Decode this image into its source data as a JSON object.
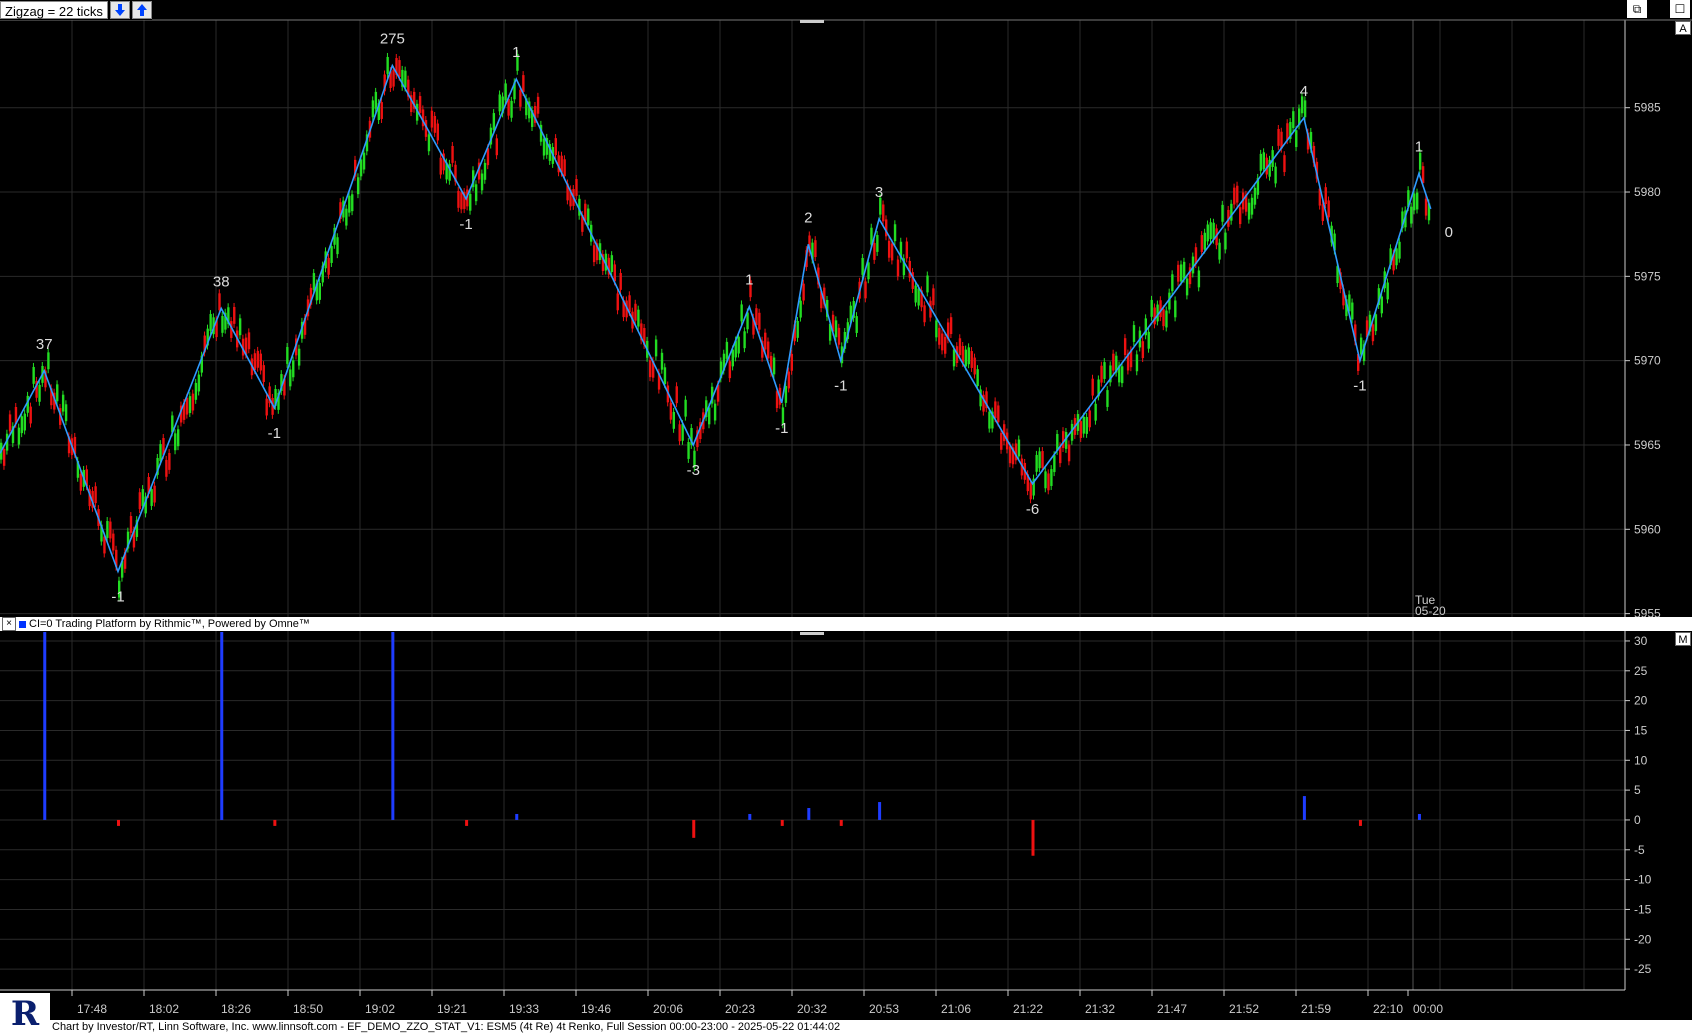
{
  "toolbar": {
    "zigzag_label": "Zigzag = 22 ticks",
    "down_icon": "arrow-down-icon",
    "up_icon": "arrow-up-icon"
  },
  "window_controls": {
    "restore": "⧉",
    "close": "☐"
  },
  "pane_tags": {
    "price": "A",
    "stat": "M"
  },
  "indicator_bar": {
    "close_label": "×",
    "text": "CI=0  Trading Platform by Rithmic™, Powered by Omne™"
  },
  "footer": {
    "text": "Chart by Investor/RT, Linn Software, Inc. www.linnsoft.com - EF_DEMO_ZZO_STAT_V1: ESM5 (4t Re) 4t Renko, Full Session 00:00-23:00 - 2025-05-22 01:44:02"
  },
  "colors": {
    "up": "#22dd22",
    "down": "#ee1111",
    "zigzag": "#2e9bff",
    "hist_up": "#1e3cff",
    "hist_down": "#ee1111",
    "grid": "#2a2a2a"
  },
  "date_label": [
    "Tue",
    "05-20"
  ],
  "chart_data": {
    "type": "line",
    "title": "",
    "price_axis": {
      "ticks": [
        "5985",
        "5980",
        "5975",
        "5970",
        "5965",
        "5960",
        "5955"
      ],
      "ylim": [
        5954.8,
        5990.2
      ]
    },
    "stat_axis": {
      "ticks": [
        "30",
        "25",
        "20",
        "15",
        "10",
        "5",
        "0",
        "-5",
        "-10",
        "-15",
        "-20",
        "-25"
      ],
      "ylim": [
        -28.5,
        31.5
      ]
    },
    "time_labels": [
      "17:48",
      "18:02",
      "18:26",
      "18:50",
      "19:02",
      "19:21",
      "19:33",
      "19:46",
      "20:06",
      "20:23",
      "20:32",
      "20:53",
      "21:06",
      "21:22",
      "21:32",
      "21:47",
      "21:52",
      "21:59",
      "22:10",
      "00:00"
    ],
    "zigzag": [
      {
        "bar": 0,
        "price": 5964.5,
        "label": ""
      },
      {
        "bar": 15,
        "price": 5969.4,
        "label": "37"
      },
      {
        "bar": 40,
        "price": 5957.5,
        "label": "-1"
      },
      {
        "bar": 75,
        "price": 5973.1,
        "label": "38"
      },
      {
        "bar": 93,
        "price": 5967.2,
        "label": "-1"
      },
      {
        "bar": 133,
        "price": 5987.5,
        "label": "275"
      },
      {
        "bar": 158,
        "price": 5979.6,
        "label": "-1"
      },
      {
        "bar": 175,
        "price": 5986.7,
        "label": "1"
      },
      {
        "bar": 235,
        "price": 5965.0,
        "label": "-3"
      },
      {
        "bar": 254,
        "price": 5973.2,
        "label": "1"
      },
      {
        "bar": 265,
        "price": 5967.5,
        "label": "-1"
      },
      {
        "bar": 274,
        "price": 5976.9,
        "label": "2"
      },
      {
        "bar": 285,
        "price": 5970.0,
        "label": "-1"
      },
      {
        "bar": 298,
        "price": 5978.4,
        "label": "3"
      },
      {
        "bar": 350,
        "price": 5962.7,
        "label": "-6"
      },
      {
        "bar": 442,
        "price": 5984.4,
        "label": "4"
      },
      {
        "bar": 461,
        "price": 5970.0,
        "label": "-1"
      },
      {
        "bar": 481,
        "price": 5981.1,
        "label": "1"
      },
      {
        "bar": 485,
        "price": 5979.0,
        "label": "0"
      }
    ],
    "histogram": [
      {
        "bar": 15,
        "value": 31.5
      },
      {
        "bar": 40,
        "value": -1
      },
      {
        "bar": 75,
        "value": 31.5
      },
      {
        "bar": 93,
        "value": -1
      },
      {
        "bar": 133,
        "value": 31.5
      },
      {
        "bar": 158,
        "value": -1
      },
      {
        "bar": 175,
        "value": 1
      },
      {
        "bar": 235,
        "value": -3
      },
      {
        "bar": 254,
        "value": 1
      },
      {
        "bar": 265,
        "value": -1
      },
      {
        "bar": 274,
        "value": 2
      },
      {
        "bar": 285,
        "value": -1
      },
      {
        "bar": 298,
        "value": 3
      },
      {
        "bar": 350,
        "value": -6
      },
      {
        "bar": 442,
        "value": 4
      },
      {
        "bar": 461,
        "value": -1
      },
      {
        "bar": 481,
        "value": 1
      }
    ],
    "grid": true
  }
}
